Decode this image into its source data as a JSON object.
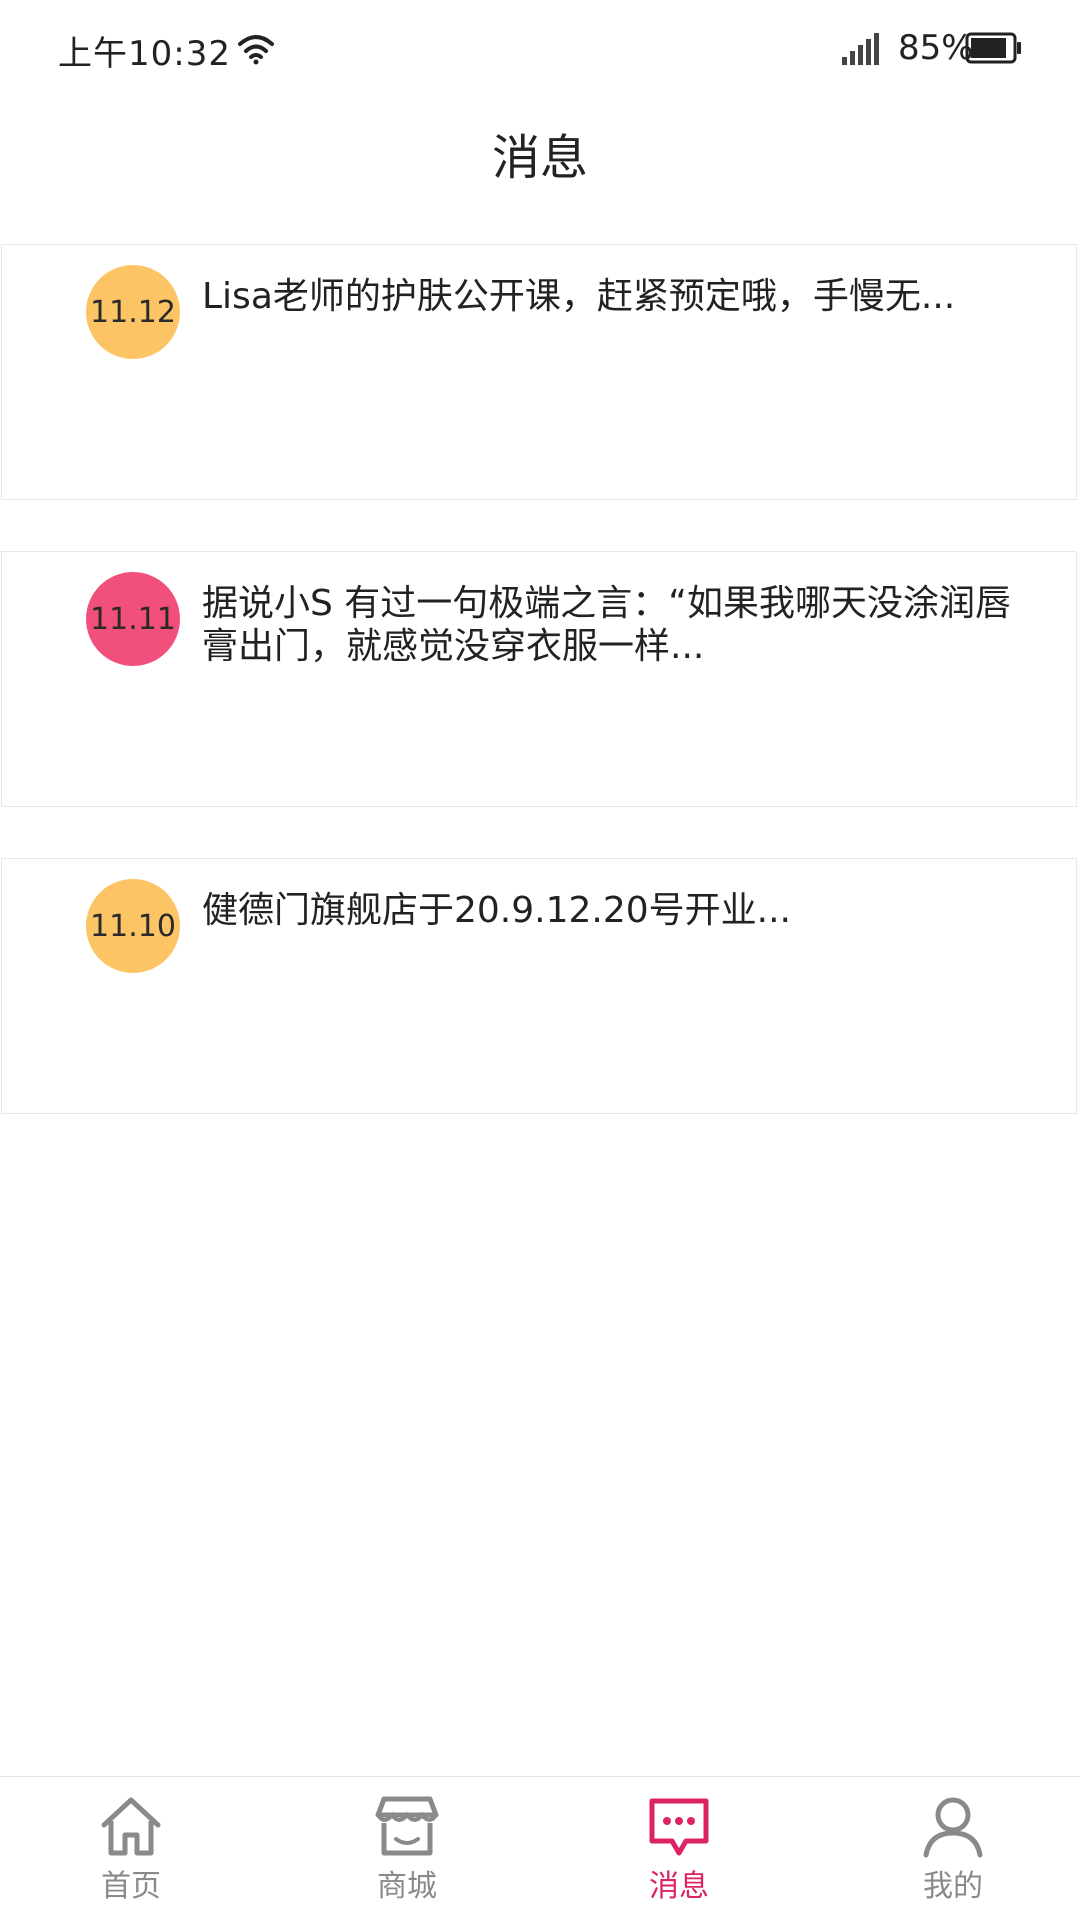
{
  "status_bar": {
    "time": "上午10:32",
    "battery": "85%"
  },
  "header": {
    "title": "消息"
  },
  "messages": [
    {
      "date": "11.12",
      "text": "Lisa老师的护肤公开课，赶紧预定哦，手慢无...",
      "badge_color": "#fcc464"
    },
    {
      "date": "11.11",
      "text": "据说小S 有过一句极端之言：“如果我哪天没涂润唇膏出门，就感觉没穿衣服一样...",
      "badge_color": "#f1507c"
    },
    {
      "date": "11.10",
      "text": "健德门旗舰店于20.9.12.20号开业...",
      "badge_color": "#fcc464"
    }
  ],
  "bottom_nav": {
    "items": [
      {
        "label": "首页",
        "icon": "home-icon",
        "active": false
      },
      {
        "label": "商城",
        "icon": "store-icon",
        "active": false
      },
      {
        "label": "消息",
        "icon": "message-icon",
        "active": true
      },
      {
        "label": "我的",
        "icon": "user-icon",
        "active": false
      }
    ],
    "active_color": "#dd2265",
    "inactive_color": "#8a8a8a"
  }
}
